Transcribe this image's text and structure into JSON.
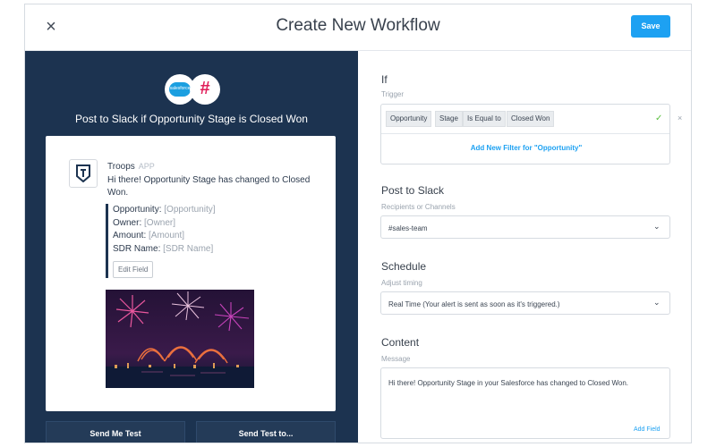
{
  "header": {
    "title": "Create New Workflow",
    "save_label": "Save",
    "close_icon": "×"
  },
  "preview": {
    "heading": "Post to Slack if Opportunity Stage is Closed Won",
    "salesforce_logo_text": "salesforce",
    "slack_logo_glyph": "#",
    "bot_name": "Troops",
    "bot_tag": "APP",
    "message": "Hi there! Opportunity Stage has changed to Closed Won.",
    "fields": [
      {
        "label": "Opportunity:",
        "value": "[Opportunity]"
      },
      {
        "label": "Owner:",
        "value": "[Owner]"
      },
      {
        "label": "Amount:",
        "value": "[Amount]"
      },
      {
        "label": "SDR Name:",
        "value": "[SDR Name]"
      }
    ],
    "edit_field_label": "Edit Field",
    "send_me_test_label": "Send Me Test",
    "send_test_to_label": "Send Test to..."
  },
  "form": {
    "if": {
      "title": "If",
      "subtitle": "Trigger",
      "chips": [
        "Opportunity",
        "Stage",
        "Is Equal to",
        "Closed Won"
      ],
      "check_icon": "✓",
      "remove_icon": "×",
      "add_filter_label": "Add New Filter for \"Opportunity\""
    },
    "post_to_slack": {
      "title": "Post to Slack",
      "subtitle": "Recipients or Channels",
      "value": "#sales-team"
    },
    "schedule": {
      "title": "Schedule",
      "subtitle": "Adjust timing",
      "value": "Real Time (Your alert is sent as soon as it's triggered.)"
    },
    "content": {
      "title": "Content",
      "subtitle": "Message",
      "message": "Hi there! Opportunity Stage in your Salesforce has changed to Closed Won.",
      "add_field_label": "Add Field"
    },
    "chevron_glyph": "⌄"
  },
  "colors": {
    "accent": "#1da1f2",
    "panel": "#1c3350",
    "check": "#5bbf3f"
  }
}
